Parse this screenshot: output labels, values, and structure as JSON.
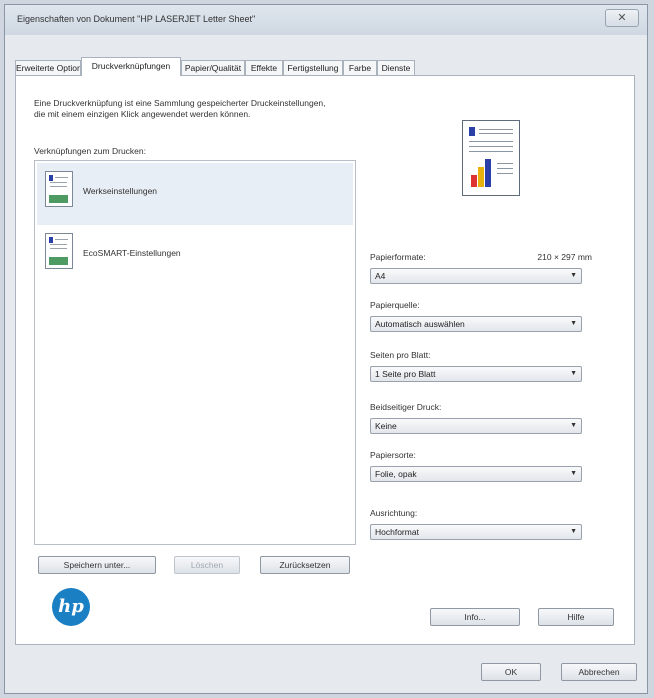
{
  "window": {
    "title": "Eigenschaften von Dokument \"HP LASERJET Letter Sheet\"",
    "close_symbol": "✕"
  },
  "tabs": [
    {
      "label": "Erweiterte Optionen",
      "active": false
    },
    {
      "label": "Druckverknüpfungen",
      "active": true
    },
    {
      "label": "Papier/Qualität",
      "active": false
    },
    {
      "label": "Effekte",
      "active": false
    },
    {
      "label": "Fertigstellung",
      "active": false
    },
    {
      "label": "Farbe",
      "active": false
    },
    {
      "label": "Dienste",
      "active": false
    }
  ],
  "shortcuts": {
    "description_line1": "Eine Druckverknüpfung ist eine Sammlung gespeicherter Druckeinstellungen,",
    "description_line2": "die mit einem einzigen Klick angewendet werden können.",
    "list_label": "Verknüpfungen zum Drucken:",
    "items": [
      {
        "label": "Werkseinstellungen",
        "selected": true
      },
      {
        "label": "EcoSMART-Einstellungen",
        "selected": false
      }
    ]
  },
  "settings": {
    "paper_size": {
      "label": "Papierformate:",
      "size": "210 × 297 mm",
      "value": "A4"
    },
    "paper_source": {
      "label": "Papierquelle:",
      "value": "Automatisch auswählen"
    },
    "pages_per_sheet": {
      "label": "Seiten pro Blatt:",
      "value": "1 Seite pro Blatt"
    },
    "duplex": {
      "label": "Beidseitiger Druck:",
      "value": "Keine"
    },
    "paper_type": {
      "label": "Papiersorte:",
      "value": "Folie, opak"
    },
    "orientation": {
      "label": "Ausrichtung:",
      "value": "Hochformat"
    }
  },
  "buttons": {
    "save_as": "Speichern unter...",
    "delete": "Löschen",
    "reset": "Zurücksetzen",
    "info": "Info...",
    "help": "Hilfe",
    "ok": "OK",
    "cancel": "Abbrechen"
  },
  "logo": {
    "text": "hp",
    "color": "#1b7fc4"
  }
}
